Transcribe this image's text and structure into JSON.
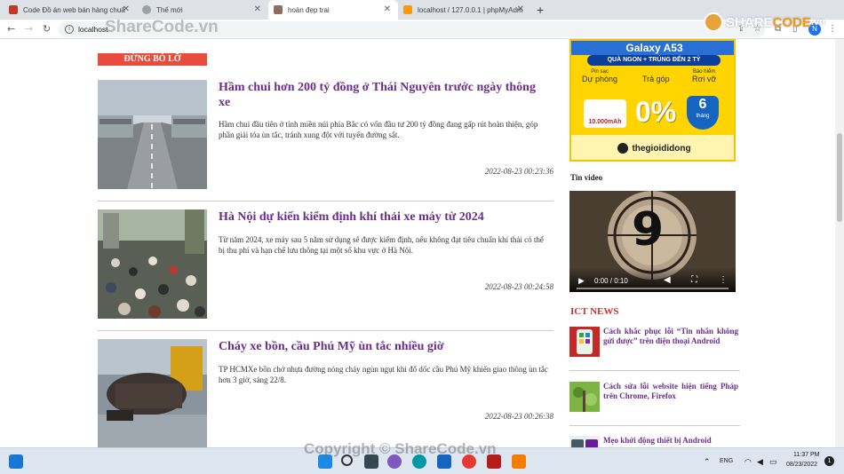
{
  "browser": {
    "tabs": [
      {
        "title": "Code Đồ án web bán hàng chuẩ"
      },
      {
        "title": "Thế mới"
      },
      {
        "title": "hoàn đẹp trai"
      },
      {
        "title": "localhost / 127.0.0.1 | phpMyAdmin"
      }
    ],
    "url": "localhost"
  },
  "watermark": {
    "top": "ShareCode.vn",
    "logo_share": "SHARE",
    "logo_code": "CODE",
    "logo_domain": ".vn",
    "bottom": "Copyright © ShareCode.vn"
  },
  "main": {
    "section_label": "ĐỪNG BỎ LỠ",
    "articles": [
      {
        "title": "Hầm chui hơn 200 tỷ đồng ở Thái Nguyên trước ngày thông xe",
        "desc": "Hầm chui đầu tiên ở tỉnh miền núi phía Bắc có vốn đầu tư 200 tỷ đồng đang gấp rút hoàn thiện, góp phần giải tỏa ùn tắc, tránh xung đột với tuyến đường sắt.",
        "date": "2022-08-23 00:23:36"
      },
      {
        "title": "Hà Nội dự kiến kiểm định khí thải xe máy từ 2024",
        "desc": "Từ năm 2024, xe máy sau 5 năm sử dụng sẽ được kiểm định, nếu không đạt tiêu chuẩn khí thải có thể bị thu phí và hạn chế lưu thông tại một số khu vực ở Hà Nội.",
        "date": "2022-08-23 00:24:58"
      },
      {
        "title": "Cháy xe bồn, cầu Phú Mỹ ùn tắc nhiều giờ",
        "desc": "TP HCMXe bồn chở nhựa đường nóng cháy ngùn ngụt khi đổ dốc cầu Phú Mỹ khiến giao thông ùn tắc hơn 3 giờ, sáng 22/8.",
        "date": "2022-08-23 00:26:38"
      }
    ]
  },
  "sidebar": {
    "ad": {
      "headline": "Galaxy A53",
      "promo": "QUÀ NGON + TRÚNG ĐẾN 2 TỶ",
      "col1_small": "Pin sạc",
      "col1_big": "Dự phòng",
      "col2_big": "Trả góp",
      "col3_small": "Bảo hiểm",
      "col3_big": "Rơi vỡ",
      "badge_amount": "10.000mAh",
      "percent": "0%",
      "months_num": "6",
      "months": "tháng",
      "brand": "thegioididong"
    },
    "video_heading": "Tin video",
    "video": {
      "countdown": "9",
      "time": "0:00 / 0:10"
    },
    "ict_heading": "ICT NEWS",
    "ict_items": [
      {
        "title": "Cách khắc phục lỗi “Tin nhắn không gửi được” trên điện thoại Android"
      },
      {
        "title": "Cách sửa lỗi website hiện tiếng Pháp trên Chrome, Firefox"
      },
      {
        "title": "Mẹo khởi động thiết bị Android"
      }
    ]
  },
  "taskbar": {
    "lang": "ENG",
    "time": "11:37 PM",
    "date": "08/23/2022",
    "notif_count": "1"
  },
  "colors": {
    "accent_purple": "#6b2d8b",
    "section_red": "#e74c3c",
    "ict_red": "#d32f2f"
  }
}
